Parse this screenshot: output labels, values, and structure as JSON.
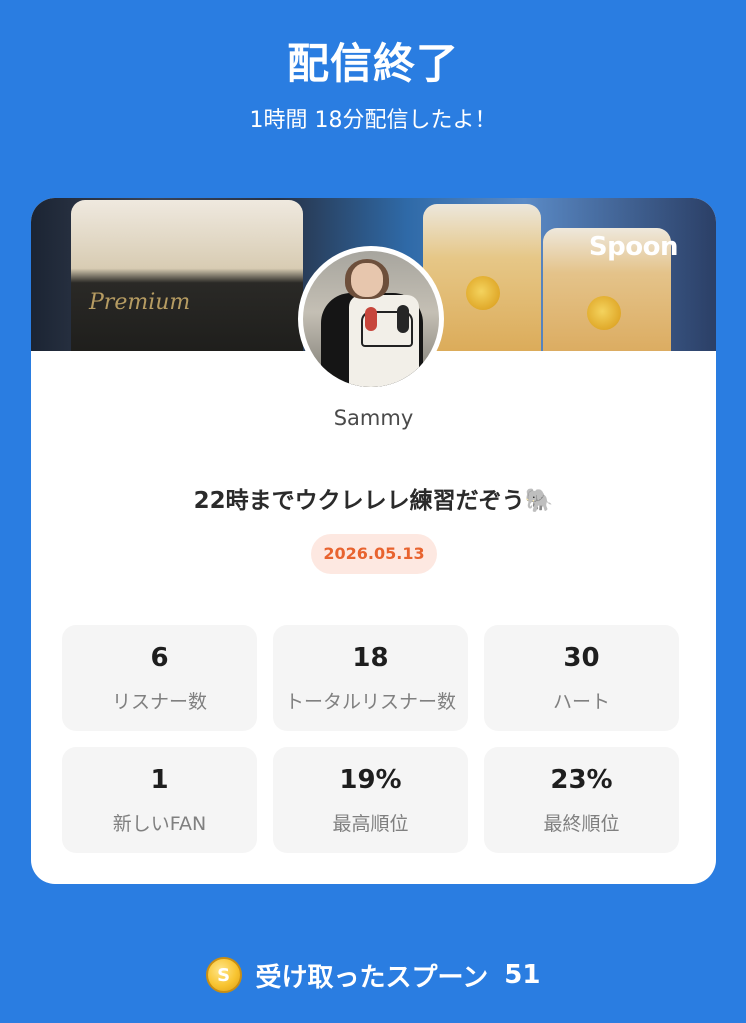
{
  "header": {
    "title": "配信終了",
    "subtitle": "1時間 18分配信したよ！"
  },
  "card": {
    "brand": "Spoon",
    "banner_text": "Premium",
    "username": "Sammy",
    "stream_title": "22時までウクレレレ練習だぞう🐘",
    "date": "2026.05.13",
    "stats": [
      {
        "value": "6",
        "label": "リスナー数"
      },
      {
        "value": "18",
        "label": "トータルリスナー数"
      },
      {
        "value": "30",
        "label": "ハート"
      },
      {
        "value": "1",
        "label": "新しいFAN"
      },
      {
        "value": "19%",
        "label": "最高順位"
      },
      {
        "value": "23%",
        "label": "最終順位"
      }
    ]
  },
  "footer": {
    "coin_icon": "S",
    "received_label": "受け取ったスプーン",
    "received_count": "51"
  },
  "colors": {
    "background": "#2A7DE1",
    "date_badge_bg": "#fde8e1",
    "date_badge_text": "#e8632f",
    "stat_bg": "#f5f5f5"
  }
}
